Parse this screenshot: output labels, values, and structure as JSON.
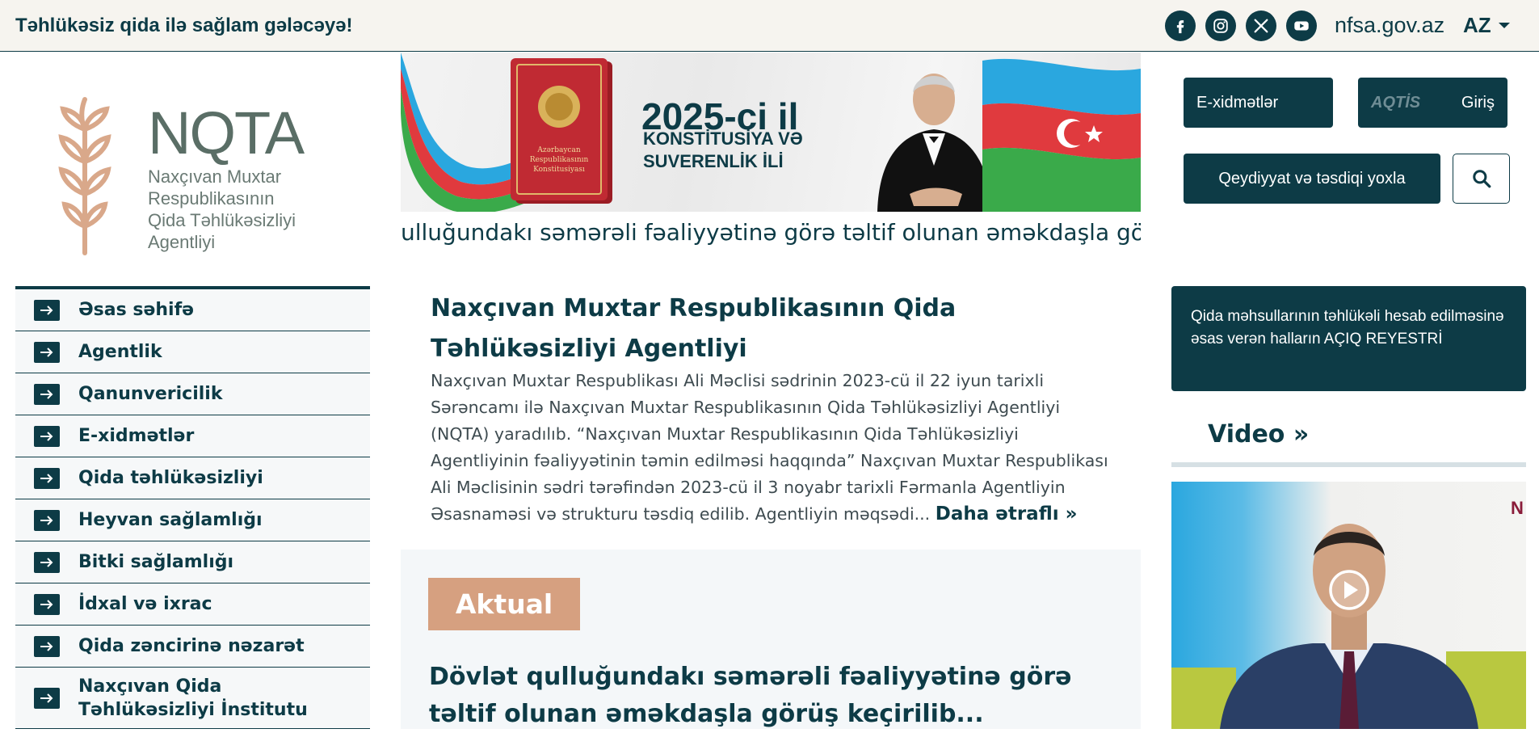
{
  "header": {
    "slogan": "Təhlükəsiz qida ilə sağlam gələcəyə!",
    "social_icons": [
      "facebook-icon",
      "instagram-icon",
      "x-icon",
      "youtube-icon"
    ],
    "domain": "nfsa.gov.az",
    "language": "AZ"
  },
  "logo": {
    "title": "NQTA",
    "subtitle_lines": [
      "Naxçıvan Muxtar",
      "Respublikasının",
      "Qida Təhlükəsizliyi",
      "Agentliyi"
    ]
  },
  "banner": {
    "year": "2025-ci il",
    "line1": "KONSTİTUSİYA VƏ",
    "line2": "SUVERENLİK İLİ",
    "book_text": [
      "Azərbaycan",
      "Respublikasının",
      "Konstitusiyası"
    ]
  },
  "ticker": "ulluğundakı səmərəli fəaliyyətinə görə təltif olunan əməkdaşla görüş keçirilib",
  "actions": {
    "eservices": "E-xidmətlər",
    "aqtis_logo": "AQTİS",
    "login": "Giriş",
    "check_registration": "Qeydiyyat və təsdiqi yoxla",
    "search_icon": "search-icon"
  },
  "sidebar": {
    "items": [
      {
        "label": "Əsas səhifə"
      },
      {
        "label": "Agentlik"
      },
      {
        "label": "Qanunvericilik"
      },
      {
        "label": "E-xidmətlər"
      },
      {
        "label": "Qida təhlükəsizliyi"
      },
      {
        "label": "Heyvan sağlamlığı"
      },
      {
        "label": "Bitki sağlamlığı"
      },
      {
        "label": "İdxal və ixrac"
      },
      {
        "label": "Qida zəncirinə nəzarət"
      },
      {
        "label": "Naxçıvan Qida",
        "label2": "Təhlükəsizliyi İnstitutu"
      }
    ]
  },
  "intro": {
    "title": "Naxçıvan Muxtar Respublikasının Qida Təhlükəsizliyi Agentliyi",
    "text": "Naxçıvan Muxtar Respublikası Ali Məclisi sədrinin 2023-cü il 22 iyun tarixli Sərəncamı ilə Naxçıvan Muxtar Respublikasının Qida Təhlükəsizliyi Agentliyi (NQTA) yaradılıb. “Naxçıvan Muxtar Respublikasının Qida Təhlükəsizliyi Agentliyinin fəaliyyətinin təmin edilməsi haqqında” Naxçıvan Muxtar Respublikası Ali Məclisinin sədri tərəfindən 2023-cü il 3 noyabr tarixli Fərmanla Agentliyin Əsasnaməsi və strukturu  təsdiq edilib.     Agentliyin məqsədi...",
    "more": "Daha ətraflı"
  },
  "news": {
    "badge": "Aktual",
    "title": "Dövlət qulluğundakı səmərəli fəaliyyətinə görə təltif olunan əməkdaşla görüş keçirilib..."
  },
  "right": {
    "registry": "Qida məhsullarının təhlükəli hesab edilməsinə əsas verən halların AÇIQ REYESTRİ",
    "video_heading": "Video"
  },
  "colors": {
    "primary": "#0d3b46",
    "accent": "#d6a080",
    "topbar_bg": "#f6f4ef"
  }
}
